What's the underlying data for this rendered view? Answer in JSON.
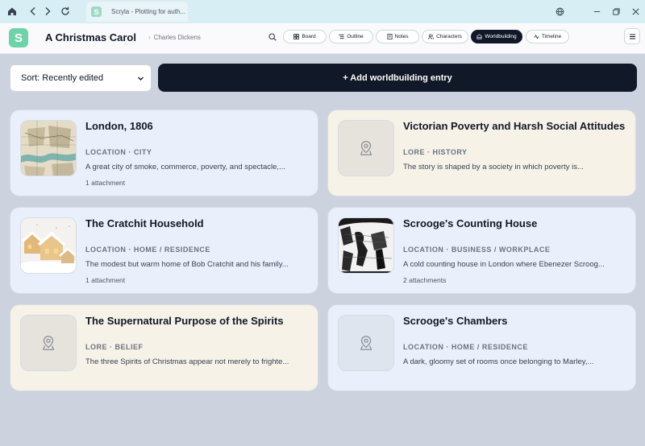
{
  "browser": {
    "tab_title": "Scryla - Plotting for auth...",
    "favicon_letter": "S"
  },
  "app": {
    "logo_letter": "S",
    "book_title": "A Christmas Carol",
    "author": "Charles Dickens",
    "nav": [
      {
        "label": "Board",
        "icon": "board-icon",
        "active": false
      },
      {
        "label": "Outline",
        "icon": "outline-icon",
        "active": false
      },
      {
        "label": "Notes",
        "icon": "notes-icon",
        "active": false
      },
      {
        "label": "Characters",
        "icon": "characters-icon",
        "active": false
      },
      {
        "label": "Worldbuilding",
        "icon": "worldbuilding-icon",
        "active": true
      },
      {
        "label": "Timeline",
        "icon": "timeline-icon",
        "active": false
      }
    ]
  },
  "toolbar": {
    "sort_value": "Sort: Recently edited",
    "add_label": "+ Add worldbuilding entry"
  },
  "entries": [
    {
      "title": "London, 1806",
      "category": "LOCATION · CITY",
      "description": "A great city of smoke, commerce, poverty, and spectacle,...",
      "attachments": "1 attachment",
      "thumb": "map"
    },
    {
      "title": "Victorian Poverty and Harsh Social Attitudes",
      "category": "LORE · HISTORY",
      "description": "The story is shaped by a society in which poverty is...",
      "attachments": "",
      "thumb": "placeholder"
    },
    {
      "title": "The Cratchit Household",
      "category": "LOCATION · HOME / RESIDENCE",
      "description": "The modest but warm home of Bob Cratchit and his family...",
      "attachments": "1 attachment",
      "thumb": "houses"
    },
    {
      "title": "Scrooge's Counting House",
      "category": "LOCATION · BUSINESS / WORKPLACE",
      "description": "A cold counting house in London where Ebenezer Scroog...",
      "attachments": "2 attachments",
      "thumb": "engraving"
    },
    {
      "title": "The Supernatural Purpose of the Spirits",
      "category": "LORE · BELIEF",
      "description": "The three Spirits of Christmas appear not merely to frighte...",
      "attachments": "",
      "thumb": "placeholder"
    },
    {
      "title": "Scrooge's Chambers",
      "category": "LOCATION · HOME / RESIDENCE",
      "description": "A dark, gloomy set of rooms once belonging to Marley,...",
      "attachments": "",
      "thumb": "placeholder"
    }
  ],
  "colors": {
    "accent": "#111827",
    "logo": "#6fd3a8",
    "card_location": "#eaf0fb",
    "card_lore": "#f7f2e8",
    "background": "#cdd3de"
  }
}
